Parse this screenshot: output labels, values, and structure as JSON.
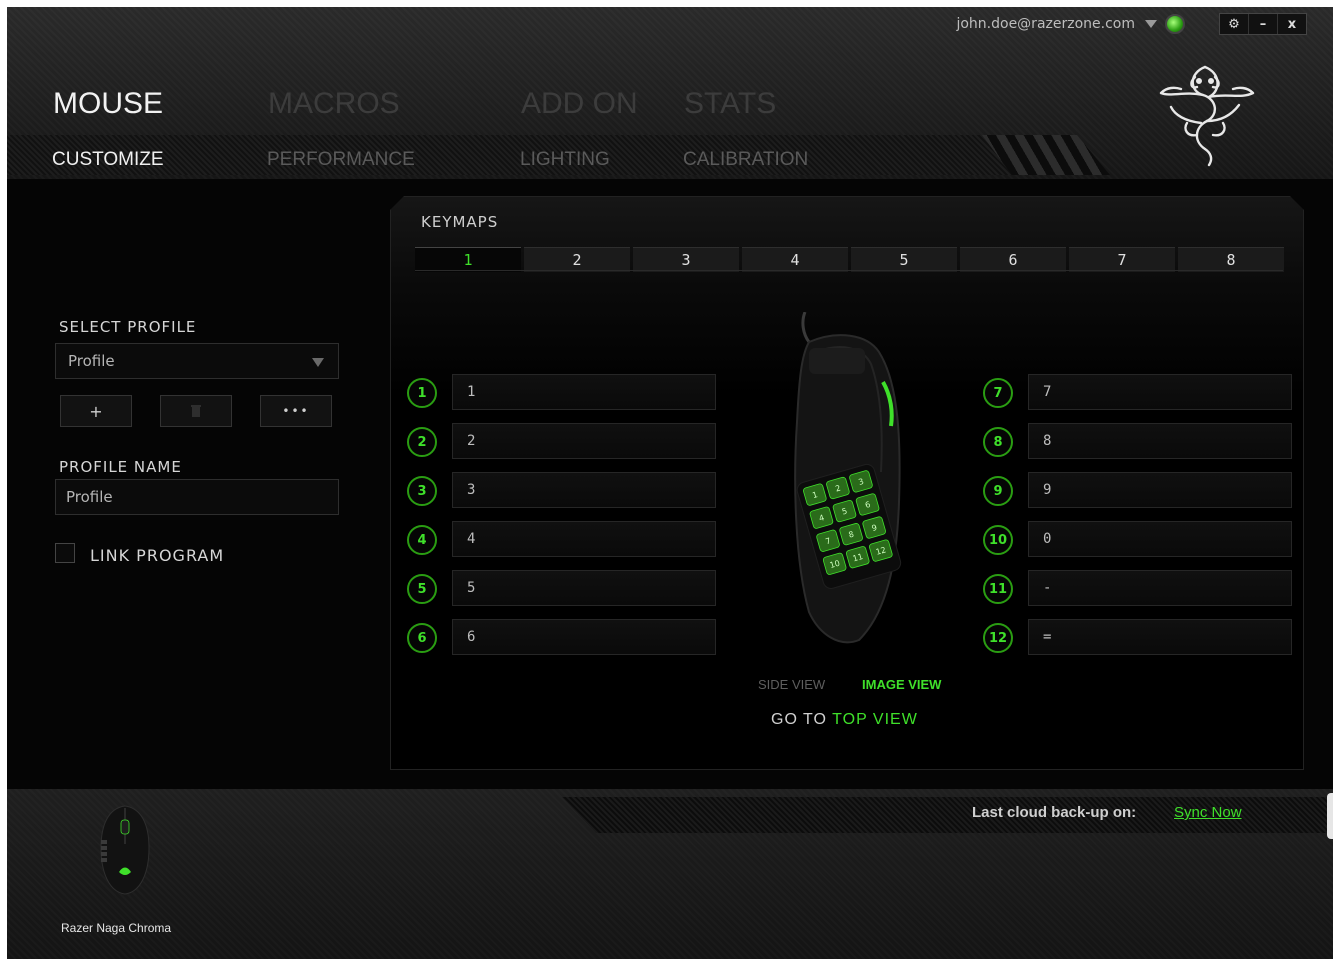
{
  "account": {
    "email": "john.doe@razerzone.com"
  },
  "window_controls": {
    "settings": "⚙",
    "minimize": "–",
    "close": "x"
  },
  "main_tabs": [
    {
      "label": "MOUSE",
      "active": true
    },
    {
      "label": "MACROS",
      "active": false
    },
    {
      "label": "ADD ON",
      "active": false
    },
    {
      "label": "STATS",
      "active": false
    }
  ],
  "sub_tabs": [
    {
      "label": "CUSTOMIZE",
      "active": true
    },
    {
      "label": "PERFORMANCE",
      "active": false
    },
    {
      "label": "LIGHTING",
      "active": false
    },
    {
      "label": "CALIBRATION",
      "active": false
    }
  ],
  "profile": {
    "select_label": "SELECT PROFILE",
    "selected": "Profile",
    "add_label": "+",
    "delete_label": "🗑",
    "more_label": "•••",
    "name_label": "PROFILE NAME",
    "name_value": "Profile",
    "link_program_label": "LINK PROGRAM",
    "link_program_checked": false
  },
  "keymaps": {
    "title": "KEYMAPS",
    "tabs": [
      "1",
      "2",
      "3",
      "4",
      "5",
      "6",
      "7",
      "8"
    ],
    "active_tab": "1",
    "left_buttons": [
      {
        "num": "1",
        "value": "1"
      },
      {
        "num": "2",
        "value": "2"
      },
      {
        "num": "3",
        "value": "3"
      },
      {
        "num": "4",
        "value": "4"
      },
      {
        "num": "5",
        "value": "5"
      },
      {
        "num": "6",
        "value": "6"
      }
    ],
    "right_buttons": [
      {
        "num": "7",
        "value": "7"
      },
      {
        "num": "8",
        "value": "8"
      },
      {
        "num": "9",
        "value": "9"
      },
      {
        "num": "10",
        "value": "0"
      },
      {
        "num": "11",
        "value": "-"
      },
      {
        "num": "12",
        "value": "="
      }
    ],
    "side_view_label": "SIDE VIEW",
    "image_view_label": "IMAGE VIEW",
    "goto_prefix": "GO TO",
    "goto_link": "TOP VIEW"
  },
  "mouse_image": {
    "keypad_labels": [
      "1",
      "2",
      "3",
      "4",
      "5",
      "6",
      "7",
      "8",
      "9",
      "10",
      "11",
      "12"
    ]
  },
  "footer": {
    "cloud_label": "Last cloud back-up on:",
    "sync_label": "Sync Now",
    "device_name": "Razer Naga Chroma"
  },
  "colors": {
    "accent_green": "#3fe02a",
    "dark_green": "#2a9d12",
    "background": "#050505"
  }
}
